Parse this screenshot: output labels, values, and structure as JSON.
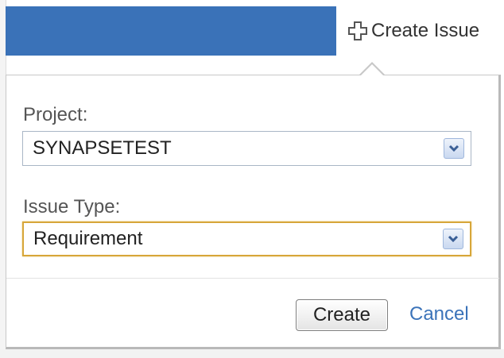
{
  "header": {
    "create_issue_label": "Create Issue"
  },
  "dialog": {
    "project": {
      "label": "Project:",
      "selected": "SYNAPSETEST"
    },
    "issue_type": {
      "label": "Issue Type:",
      "selected": "Requirement"
    },
    "actions": {
      "create_label": "Create",
      "cancel_label": "Cancel"
    }
  },
  "colors": {
    "header_bar": "#3a72b8",
    "link": "#3b73b9",
    "focus_border": "#d7a639"
  },
  "icons": {
    "create_issue": "plus-icon",
    "dropdown": "chevron-down-icon"
  }
}
